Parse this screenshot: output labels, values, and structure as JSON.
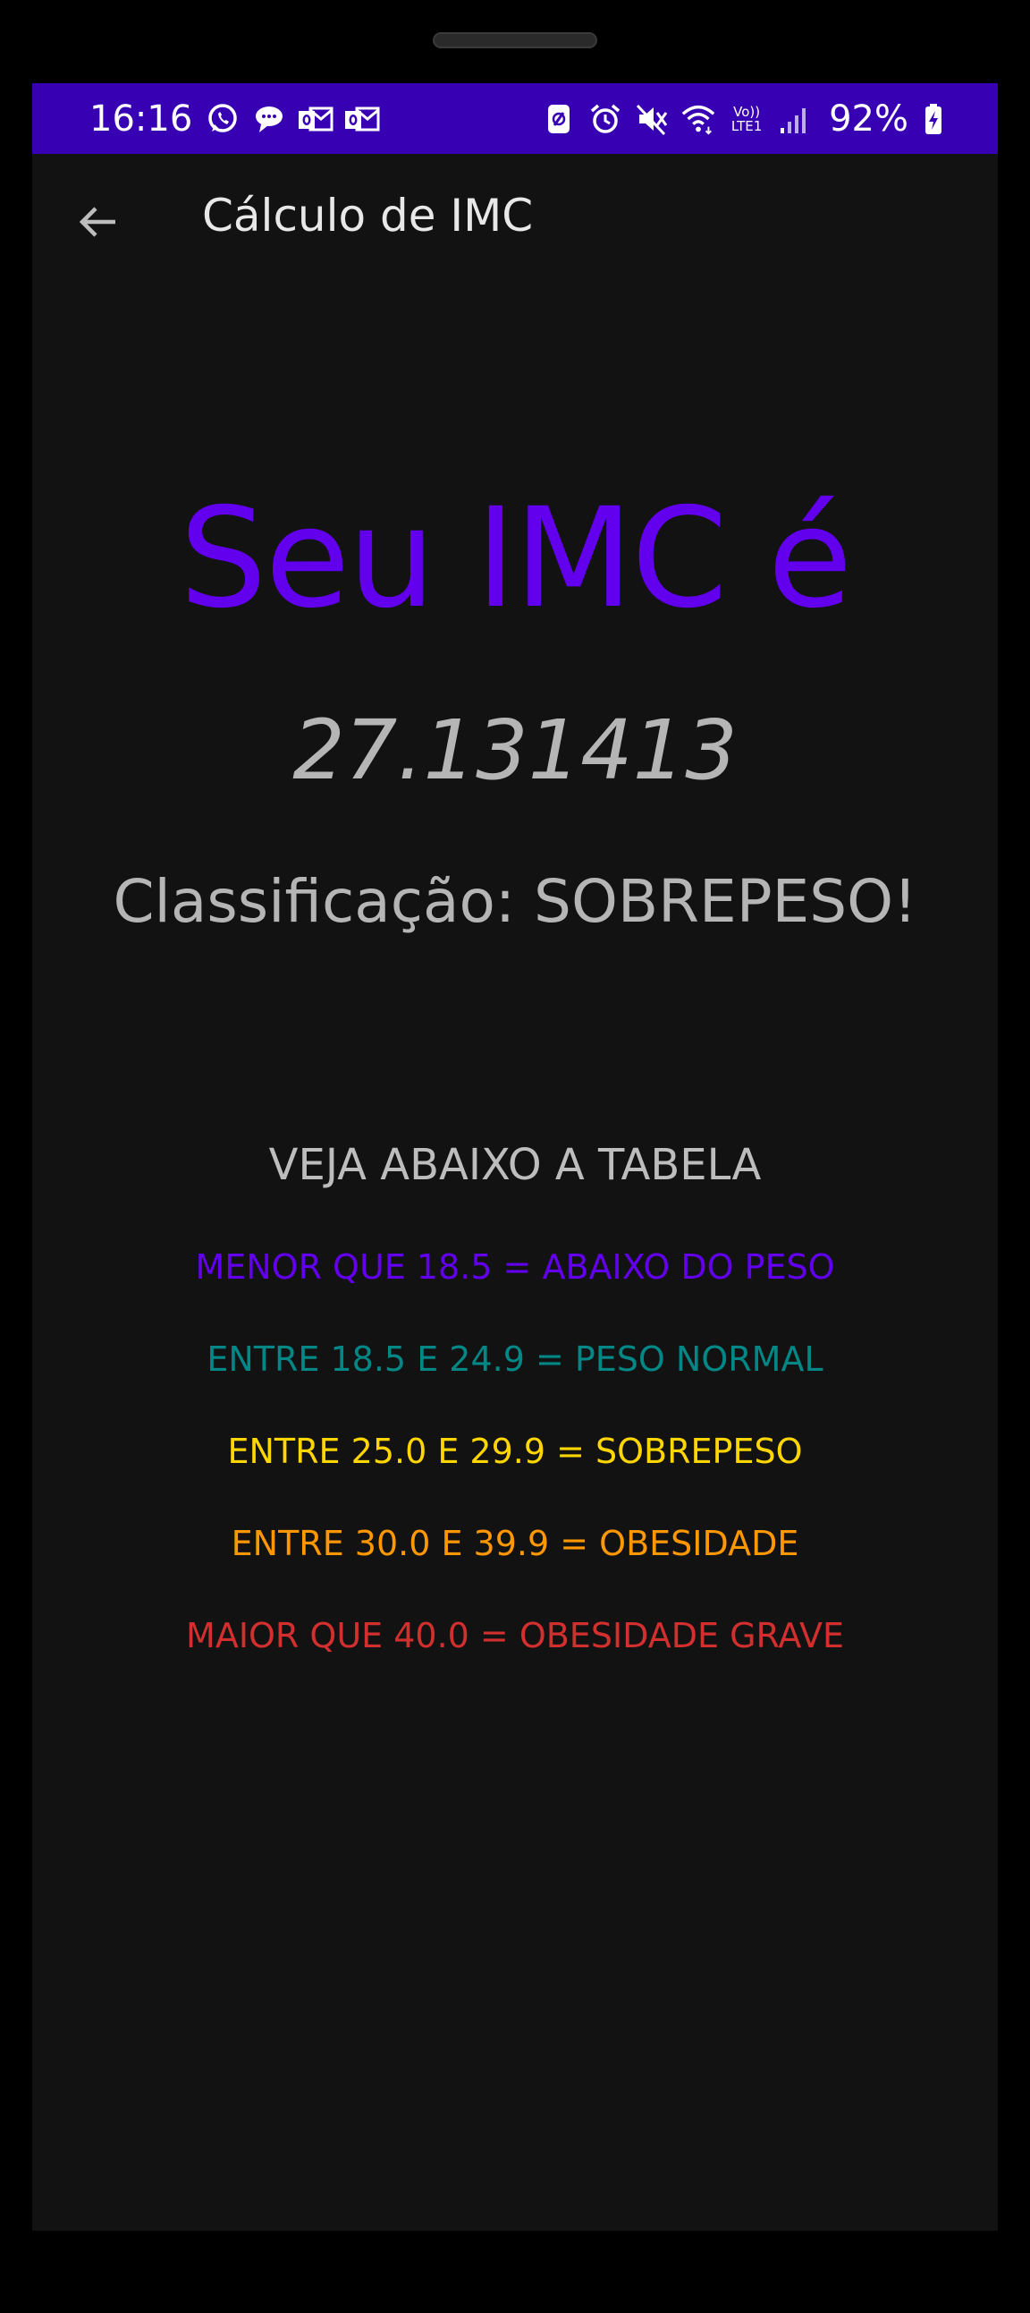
{
  "status_bar": {
    "time": "16:16",
    "battery_percent": "92%",
    "background": "#3700B3",
    "left_icons": [
      "whatsapp-icon",
      "chat-bubble-icon",
      "outlook-icon",
      "outlook-icon"
    ],
    "right_icons": [
      "nfc-icon",
      "alarm-icon",
      "mute-icon",
      "wifi-icon",
      "volte-lte-icon",
      "signal-icon",
      "battery-charging-icon"
    ],
    "network_label_top": "Vo))",
    "network_label_bottom": "LTE1"
  },
  "app_bar": {
    "title": "Cálculo de IMC",
    "back_icon": "arrow-back-icon"
  },
  "result": {
    "headline": "Seu IMC é",
    "value": "27.131413",
    "classification": "Classificação: SOBREPESO!",
    "headline_color": "#6200EE"
  },
  "table": {
    "title": "VEJA ABAIXO A TABELA",
    "rows": [
      {
        "text": "MENOR QUE 18.5 = ABAIXO DO PESO",
        "color": "#6200EE"
      },
      {
        "text": "ENTRE 18.5 E 24.9 = PESO NORMAL",
        "color": "#018786"
      },
      {
        "text": "ENTRE 25.0 E 29.9 = SOBREPESO",
        "color": "#FFD600"
      },
      {
        "text": "ENTRE 30.0 E 39.9 = OBESIDADE",
        "color": "#FF9800"
      },
      {
        "text": "MAIOR QUE 40.0 = OBESIDADE GRAVE",
        "color": "#D32F2F"
      }
    ]
  }
}
